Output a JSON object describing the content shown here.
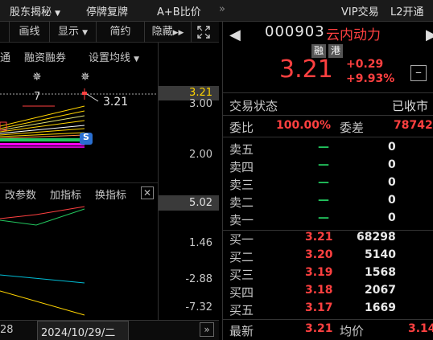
{
  "topbar": {
    "menu_gudong": "股东揭秘",
    "menu_tingpai": "停牌复牌",
    "menu_ab": "A+B比价",
    "menu_more": "»",
    "vip": "VIP交易",
    "l2": "L2开通"
  },
  "toolbar": {
    "draw": "画线",
    "display": "显示",
    "simple": "简约",
    "hide": "隐藏"
  },
  "chart_tabs": {
    "tab_tong": "通",
    "tab_margin": "融资融券",
    "tab_ma": "设置均线"
  },
  "main_chart": {
    "marker_7": "7",
    "price_label": "3.21",
    "s_badge": "S",
    "axis": [
      "3.21",
      "3.00",
      "2.00"
    ]
  },
  "sub_chart": {
    "tab_param": "改参数",
    "tab_add": "加指标",
    "tab_switch": "换指标",
    "axis": [
      "5.02",
      "1.46",
      "-2.88",
      "-7.32"
    ]
  },
  "bottom": {
    "left_num": "28",
    "date": "2024/10/29/二"
  },
  "quote": {
    "code": "000903",
    "name": "云内动力",
    "badge_rong": "融",
    "badge_gang": "港",
    "price": "3.21",
    "change": "+0.29",
    "change_pct": "+9.93%",
    "status_label": "交易状态",
    "status_value": "已收市",
    "weibi_label": "委比",
    "weibi_value": "100.00%",
    "weicha_label": "委差",
    "weicha_value": "78742",
    "sell": [
      {
        "label": "卖五",
        "price": "—",
        "vol": "0"
      },
      {
        "label": "卖四",
        "price": "—",
        "vol": "0"
      },
      {
        "label": "卖三",
        "price": "—",
        "vol": "0"
      },
      {
        "label": "卖二",
        "price": "—",
        "vol": "0"
      },
      {
        "label": "卖一",
        "price": "—",
        "vol": "0"
      }
    ],
    "buy": [
      {
        "label": "买一",
        "price": "3.21",
        "vol": "68298"
      },
      {
        "label": "买二",
        "price": "3.20",
        "vol": "5140"
      },
      {
        "label": "买三",
        "price": "3.19",
        "vol": "1568"
      },
      {
        "label": "买四",
        "price": "3.18",
        "vol": "2067"
      },
      {
        "label": "买五",
        "price": "3.17",
        "vol": "1669"
      }
    ],
    "latest_label": "最新",
    "latest_value": "3.21",
    "avg_label": "均价",
    "avg_value": "3.14"
  },
  "colors": {
    "up": "#ff4040",
    "down": "#22c55e",
    "ma1": "#ffd400",
    "ma2": "#ff00ff",
    "s_badge": "#2a6fd1"
  }
}
